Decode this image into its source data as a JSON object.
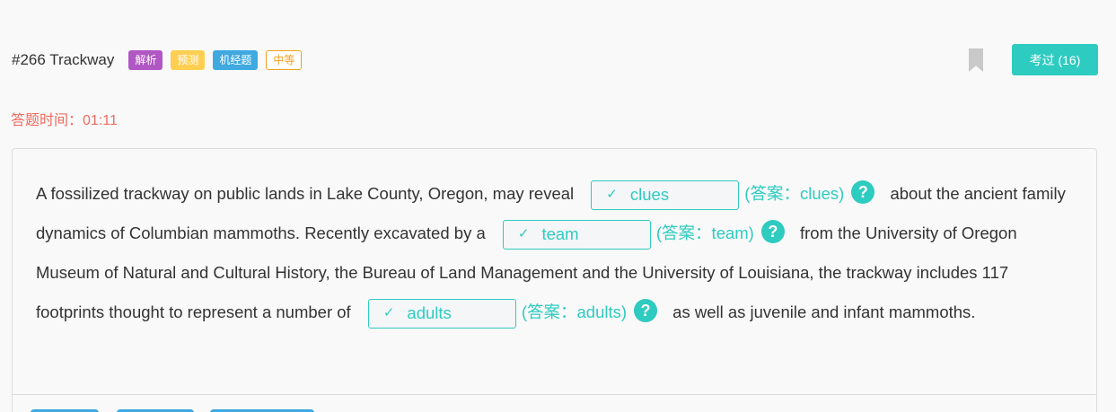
{
  "header": {
    "title": "#266 Trackway",
    "tags": [
      "解析",
      "预测",
      "机经题",
      "中等"
    ],
    "kaoguo_label": "考过 (16)"
  },
  "timer": {
    "label": "答题时间：",
    "value": "01:11"
  },
  "passage": {
    "seg1": "A fossilized trackway on public lands in Lake County, Oregon, may reveal",
    "blank1": {
      "value": "clues",
      "answer": "(答案：clues)"
    },
    "seg2": "about the ancient family dynamics of Columbian mammoths. Recently excavated by a",
    "blank2": {
      "value": "team",
      "answer": "(答案：team)"
    },
    "seg3": "from the University of Oregon Museum of Natural and Cultural History, the Bureau of Land Management and the University of Louisiana, the trackway includes 117 footprints thought to represent a number of",
    "blank3": {
      "value": "adults",
      "answer": "(答案：adults)"
    },
    "seg4": "as well as juvenile and infant mammoths."
  },
  "icons": {
    "check": "✓",
    "help": "?"
  },
  "colors": {
    "accent": "#2ecbc0",
    "timer": "#ef6b5f",
    "tag_jiexi": "#b157c4",
    "tag_yuce": "#ffcf52",
    "tag_jijing": "#3fa9e0",
    "tag_level": "#f0a020"
  }
}
